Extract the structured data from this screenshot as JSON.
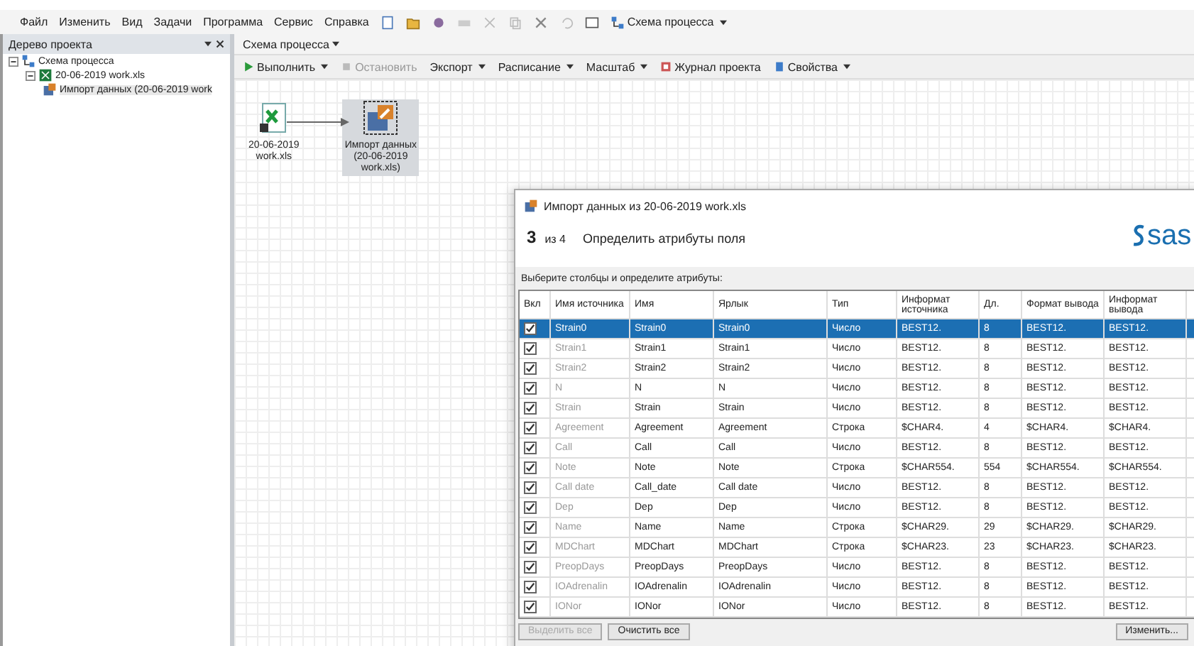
{
  "menu": {
    "items": [
      "Файл",
      "Изменить",
      "Вид",
      "Задачи",
      "Программа",
      "Сервис",
      "Справка"
    ],
    "flow_label": "Схема процесса"
  },
  "project_tree": {
    "title": "Дерево проекта",
    "items": [
      {
        "label": "Схема процесса",
        "kind": "flow",
        "expanded": true,
        "selected": false,
        "children": [
          {
            "label": "20-06-2019 work.xls",
            "kind": "excel",
            "expanded": true,
            "selected": false,
            "children": [
              {
                "label": "Импорт данных (20-06-2019 work",
                "kind": "task",
                "selected": true
              }
            ]
          }
        ]
      }
    ]
  },
  "flow_tab": {
    "label": "Схема процесса"
  },
  "toolbar": [
    {
      "label": "Выполнить",
      "kind": "run",
      "dropdown": true,
      "disabled": false
    },
    {
      "label": "Остановить",
      "kind": "stop",
      "dropdown": false,
      "disabled": true
    },
    {
      "label": "Экспорт",
      "kind": "text",
      "dropdown": true,
      "disabled": false
    },
    {
      "label": "Расписание",
      "kind": "text",
      "dropdown": true,
      "disabled": false
    },
    {
      "label": "Масштаб",
      "kind": "text",
      "dropdown": true,
      "disabled": false
    },
    {
      "label": "Журнал проекта",
      "kind": "log",
      "dropdown": false,
      "disabled": false
    },
    {
      "label": "Свойства",
      "kind": "props",
      "dropdown": true,
      "disabled": false
    }
  ],
  "canvas_nodes": [
    {
      "kind": "excel",
      "lines": [
        "20-06-2019",
        "work.xls"
      ],
      "selected": false
    },
    {
      "kind": "task",
      "lines": [
        "Импорт данных",
        "(20-06-2019",
        "work.xls)"
      ],
      "selected": true
    }
  ],
  "dialog": {
    "title": "Импорт данных из 20-06-2019 work.xls",
    "step": "3",
    "step_of": "из 4",
    "step_title": "Определить атрибуты поля",
    "logo_text": "sas",
    "instruction": "Выберите столбцы и определите атрибуты:",
    "check_column": "Вкл",
    "columns": [
      "Имя источника",
      "Имя",
      "Ярлык",
      "Тип",
      "Информат источника",
      "Дл.",
      "Формат вывода",
      "Информат вывода"
    ],
    "rows": [
      {
        "checked": true,
        "selected": true,
        "cells": [
          "Strain0",
          "Strain0",
          "Strain0",
          "Число",
          "BEST12.",
          "8",
          "BEST12.",
          "BEST12."
        ]
      },
      {
        "checked": true,
        "selected": false,
        "cells": [
          "Strain1",
          "Strain1",
          "Strain1",
          "Число",
          "BEST12.",
          "8",
          "BEST12.",
          "BEST12."
        ]
      },
      {
        "checked": true,
        "selected": false,
        "cells": [
          "Strain2",
          "Strain2",
          "Strain2",
          "Число",
          "BEST12.",
          "8",
          "BEST12.",
          "BEST12."
        ]
      },
      {
        "checked": true,
        "selected": false,
        "cells": [
          "N",
          "N",
          "N",
          "Число",
          "BEST12.",
          "8",
          "BEST12.",
          "BEST12."
        ]
      },
      {
        "checked": true,
        "selected": false,
        "cells": [
          "Strain",
          "Strain",
          "Strain",
          "Число",
          "BEST12.",
          "8",
          "BEST12.",
          "BEST12."
        ]
      },
      {
        "checked": true,
        "selected": false,
        "cells": [
          "Agreement",
          "Agreement",
          "Agreement",
          "Строка",
          "$CHAR4.",
          "4",
          "$CHAR4.",
          "$CHAR4."
        ]
      },
      {
        "checked": true,
        "selected": false,
        "cells": [
          "Call",
          "Call",
          "Call",
          "Число",
          "BEST12.",
          "8",
          "BEST12.",
          "BEST12."
        ]
      },
      {
        "checked": true,
        "selected": false,
        "cells": [
          "Note",
          "Note",
          "Note",
          "Строка",
          "$CHAR554.",
          "554",
          "$CHAR554.",
          "$CHAR554."
        ]
      },
      {
        "checked": true,
        "selected": false,
        "cells": [
          "Call date",
          "Call_date",
          "Call date",
          "Число",
          "BEST12.",
          "8",
          "BEST12.",
          "BEST12."
        ]
      },
      {
        "checked": true,
        "selected": false,
        "cells": [
          "Dep",
          "Dep",
          "Dep",
          "Число",
          "BEST12.",
          "8",
          "BEST12.",
          "BEST12."
        ]
      },
      {
        "checked": true,
        "selected": false,
        "cells": [
          "Name",
          "Name",
          "Name",
          "Строка",
          "$CHAR29.",
          "29",
          "$CHAR29.",
          "$CHAR29."
        ]
      },
      {
        "checked": true,
        "selected": false,
        "cells": [
          "MDChart",
          "MDChart",
          "MDChart",
          "Строка",
          "$CHAR23.",
          "23",
          "$CHAR23.",
          "$CHAR23."
        ]
      },
      {
        "checked": true,
        "selected": false,
        "cells": [
          "PreopDays",
          "PreopDays",
          "PreopDays",
          "Число",
          "BEST12.",
          "8",
          "BEST12.",
          "BEST12."
        ]
      },
      {
        "checked": true,
        "selected": false,
        "cells": [
          "IOAdrenalin",
          "IOAdrenalin",
          "IOAdrenalin",
          "Число",
          "BEST12.",
          "8",
          "BEST12.",
          "BEST12."
        ]
      },
      {
        "checked": true,
        "selected": false,
        "cells": [
          "IONor",
          "IONor",
          "IONor",
          "Число",
          "BEST12.",
          "8",
          "BEST12.",
          "BEST12."
        ]
      }
    ],
    "buttons": [
      {
        "label": "Выделить все",
        "disabled": true
      },
      {
        "label": "Очистить все",
        "disabled": false
      },
      {
        "label": "Изменить...",
        "disabled": false
      }
    ]
  }
}
